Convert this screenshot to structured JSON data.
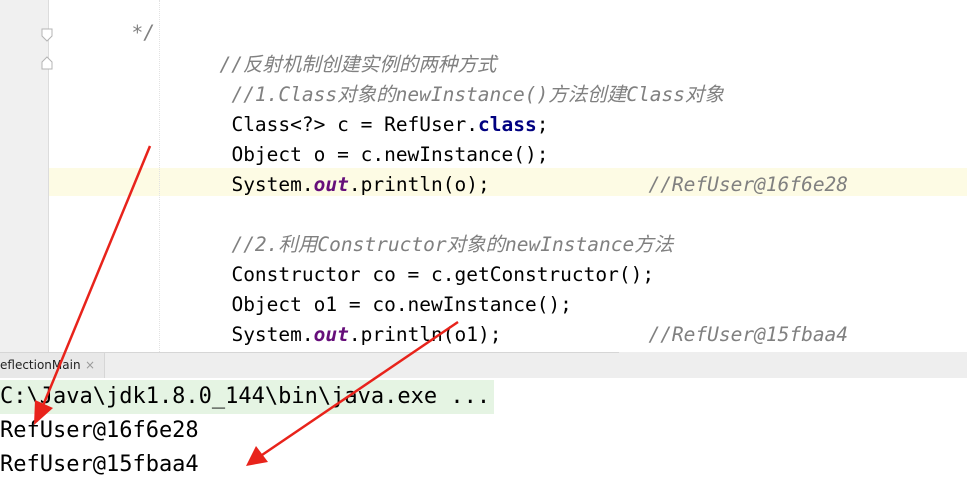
{
  "editor": {
    "partial_top": "*/",
    "lines": [
      {
        "comment": "//反射机制创建实例的两种方式"
      },
      {
        "comment": "//1.Class对象的newInstance()方法创建Class对象"
      },
      {
        "code_a": "Class<?> c = RefUser.",
        "kw": "class",
        "code_b": ";"
      },
      {
        "code": "Object o = c.newInstance();"
      },
      {
        "code_a": "System.",
        "static_field": "out",
        "code_b": ".println(o);",
        "trailing_comment": "//RefUser@16f6e28"
      },
      {
        "comment": "//2.利用Constructor对象的newInstance方法"
      },
      {
        "code": "Constructor co = c.getConstructor();"
      },
      {
        "code": "Object o1 = co.newInstance();"
      },
      {
        "code_a": "System.",
        "static_field": "out",
        "code_b": ".println(o1);",
        "trailing_comment": "//RefUser@15fbaa4"
      }
    ]
  },
  "run_panel": {
    "tab_label": "eflectionMain",
    "close_glyph": "×"
  },
  "console": {
    "command": "C:\\Java\\jdk1.8.0_144\\bin\\java.exe ...",
    "output": [
      "RefUser@16f6e28",
      "RefUser@15fbaa4"
    ]
  },
  "colors": {
    "comment": "#808080",
    "keyword": "#000080",
    "static_field": "#660e7a",
    "current_line": "#fdfbe4",
    "console_cmd_bg": "#e5f4e3",
    "annotation_arrow": "#e8231b"
  }
}
